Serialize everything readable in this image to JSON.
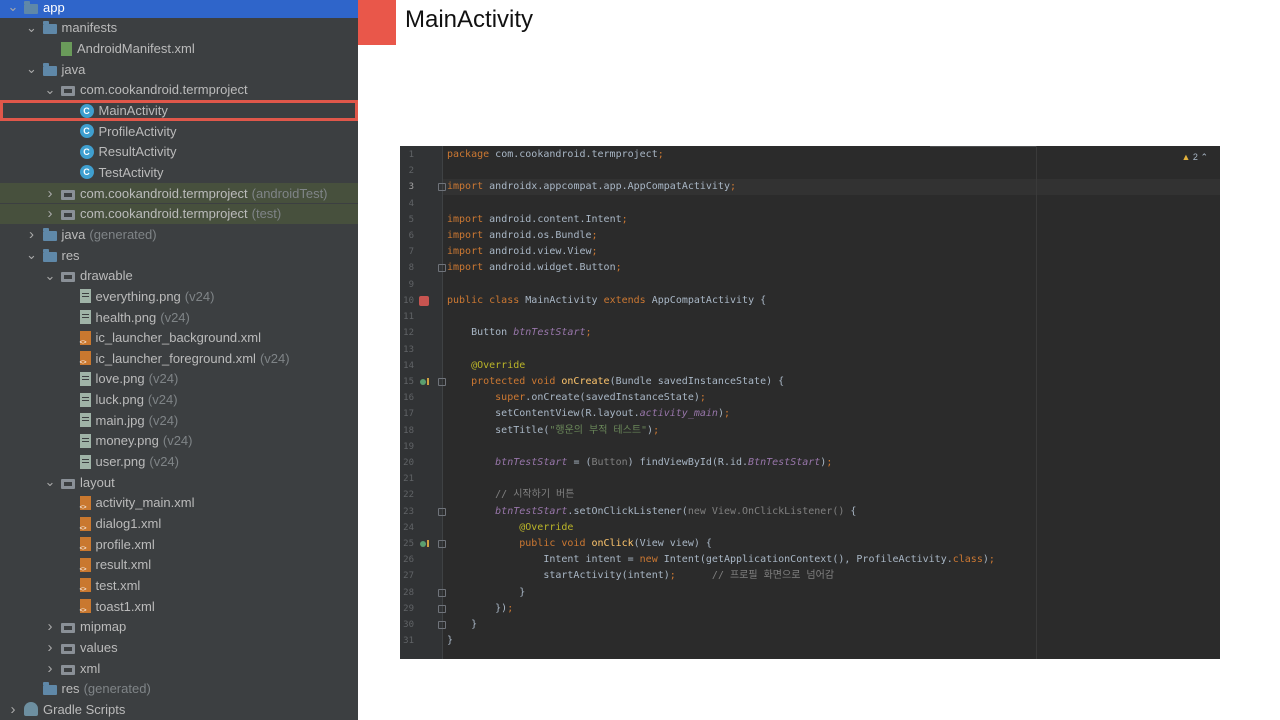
{
  "tree": [
    {
      "label": "app",
      "icon": "folder-icon",
      "chev": "v",
      "indent": 0,
      "selected": true
    },
    {
      "label": "manifests",
      "icon": "folder-icon",
      "chev": "v",
      "indent": 1
    },
    {
      "label": "AndroidManifest.xml",
      "icon": "manifest-file-icon",
      "indent": 2
    },
    {
      "label": "java",
      "icon": "folder-icon",
      "chev": "v",
      "indent": 1
    },
    {
      "label": "com.cookandroid.termproject",
      "icon": "package-icon",
      "chev": "v",
      "indent": 2
    },
    {
      "label": "MainActivity",
      "icon": "class-icon",
      "indent": 3,
      "boxed": true
    },
    {
      "label": "ProfileActivity",
      "icon": "class-icon",
      "indent": 3
    },
    {
      "label": "ResultActivity",
      "icon": "class-icon",
      "indent": 3
    },
    {
      "label": "TestActivity",
      "icon": "class-icon",
      "indent": 3
    },
    {
      "label": "com.cookandroid.termproject",
      "suffix": "(androidTest)",
      "icon": "package-icon",
      "chev": ">",
      "indent": 2,
      "tint": true
    },
    {
      "label": "com.cookandroid.termproject",
      "suffix": "(test)",
      "icon": "package-icon",
      "chev": ">",
      "indent": 2,
      "tint": true
    },
    {
      "label": "java",
      "suffix": "(generated)",
      "icon": "folder-icon",
      "chev": ">",
      "indent": 1
    },
    {
      "label": "res",
      "icon": "res-folder-icon",
      "chev": "v",
      "indent": 1
    },
    {
      "label": "drawable",
      "icon": "package-icon",
      "chev": "v",
      "indent": 2
    },
    {
      "label": "everything.png",
      "suffix": "(v24)",
      "icon": "image-file-icon",
      "indent": 3
    },
    {
      "label": "health.png",
      "suffix": "(v24)",
      "icon": "image-file-icon",
      "indent": 3
    },
    {
      "label": "ic_launcher_background.xml",
      "icon": "xml-file-icon",
      "indent": 3
    },
    {
      "label": "ic_launcher_foreground.xml",
      "suffix": "(v24)",
      "icon": "xml-file-icon",
      "indent": 3
    },
    {
      "label": "love.png",
      "suffix": "(v24)",
      "icon": "image-file-icon",
      "indent": 3
    },
    {
      "label": "luck.png",
      "suffix": "(v24)",
      "icon": "image-file-icon",
      "indent": 3
    },
    {
      "label": "main.jpg",
      "suffix": "(v24)",
      "icon": "image-file-icon",
      "indent": 3
    },
    {
      "label": "money.png",
      "suffix": "(v24)",
      "icon": "image-file-icon",
      "indent": 3
    },
    {
      "label": "user.png",
      "suffix": "(v24)",
      "icon": "image-file-icon",
      "indent": 3
    },
    {
      "label": "layout",
      "icon": "package-icon",
      "chev": "v",
      "indent": 2
    },
    {
      "label": "activity_main.xml",
      "icon": "xml-file-icon",
      "indent": 3
    },
    {
      "label": "dialog1.xml",
      "icon": "xml-file-icon",
      "indent": 3
    },
    {
      "label": "profile.xml",
      "icon": "xml-file-icon",
      "indent": 3
    },
    {
      "label": "result.xml",
      "icon": "xml-file-icon",
      "indent": 3
    },
    {
      "label": "test.xml",
      "icon": "xml-file-icon",
      "indent": 3
    },
    {
      "label": "toast1.xml",
      "icon": "xml-file-icon",
      "indent": 3
    },
    {
      "label": "mipmap",
      "icon": "package-icon",
      "chev": ">",
      "indent": 2
    },
    {
      "label": "values",
      "icon": "package-icon",
      "chev": ">",
      "indent": 2
    },
    {
      "label": "xml",
      "icon": "package-icon",
      "chev": ">",
      "indent": 2
    },
    {
      "label": "res",
      "suffix": "(generated)",
      "icon": "res-folder-icon",
      "indent": 1
    },
    {
      "label": "Gradle Scripts",
      "icon": "gradle-icon",
      "chev": ">",
      "indent": 0
    }
  ],
  "slide": {
    "title": "MainActivity"
  },
  "editor": {
    "warning_count": "2",
    "lines": [
      {
        "n": "1",
        "tokens": [
          [
            "kw",
            "package "
          ],
          [
            "",
            "com.cookandroid.termproject"
          ],
          [
            "kw",
            ";"
          ]
        ]
      },
      {
        "n": "2",
        "tokens": []
      },
      {
        "n": "3",
        "fold": true,
        "tokens": [
          [
            "kw",
            "import "
          ],
          [
            "",
            "androidx.appcompat.app.AppCompatActivity"
          ],
          [
            "kw",
            ";"
          ]
        ]
      },
      {
        "n": "4",
        "tokens": []
      },
      {
        "n": "5",
        "tokens": [
          [
            "kw",
            "import "
          ],
          [
            "",
            "android.content.Intent"
          ],
          [
            "kw",
            ";"
          ]
        ]
      },
      {
        "n": "6",
        "tokens": [
          [
            "kw",
            "import "
          ],
          [
            "",
            "android.os.Bundle"
          ],
          [
            "kw",
            ";"
          ]
        ]
      },
      {
        "n": "7",
        "tokens": [
          [
            "kw",
            "import "
          ],
          [
            "",
            "android.view.View"
          ],
          [
            "kw",
            ";"
          ]
        ]
      },
      {
        "n": "8",
        "fold": true,
        "tokens": [
          [
            "kw",
            "import "
          ],
          [
            "",
            "android.widget.Button"
          ],
          [
            "kw",
            ";"
          ]
        ]
      },
      {
        "n": "9",
        "tokens": []
      },
      {
        "n": "10",
        "marker": "run",
        "tokens": [
          [
            "kw",
            "public class "
          ],
          [
            "",
            "MainActivity "
          ],
          [
            "kw",
            "extends "
          ],
          [
            "",
            "AppCompatActivity {"
          ]
        ]
      },
      {
        "n": "11",
        "tokens": []
      },
      {
        "n": "12",
        "tokens": [
          [
            "",
            "    Button "
          ],
          [
            "it",
            "btnTestStart"
          ],
          [
            "kw",
            ";"
          ]
        ]
      },
      {
        "n": "13",
        "tokens": []
      },
      {
        "n": "14",
        "tokens": [
          [
            "ann",
            "    @Override"
          ]
        ]
      },
      {
        "n": "15",
        "marker": "override",
        "fold": true,
        "tokens": [
          [
            "kw",
            "    protected void "
          ],
          [
            "fn",
            "onCreate"
          ],
          [
            "",
            "(Bundle savedInstanceState) {"
          ]
        ]
      },
      {
        "n": "16",
        "tokens": [
          [
            "kw",
            "        super"
          ],
          [
            "",
            "."
          ],
          [
            "",
            "onCreate(savedInstanceState)"
          ],
          [
            "kw",
            ";"
          ]
        ]
      },
      {
        "n": "17",
        "tokens": [
          [
            "",
            "        setContentView(R.layout."
          ],
          [
            "it",
            "activity_main"
          ],
          [
            "",
            ")"
          ],
          [
            "kw",
            ";"
          ]
        ]
      },
      {
        "n": "18",
        "tokens": [
          [
            "",
            "        setTitle("
          ],
          [
            "str",
            "\"행운의 부적 테스트\""
          ],
          [
            "",
            ")"
          ],
          [
            "kw",
            ";"
          ]
        ]
      },
      {
        "n": "19",
        "tokens": []
      },
      {
        "n": "20",
        "tokens": [
          [
            "it",
            "        btnTestStart "
          ],
          [
            "",
            "= ("
          ],
          [
            "cm",
            "Button"
          ],
          [
            "",
            ") findViewById(R.id."
          ],
          [
            "it",
            "BtnTestStart"
          ],
          [
            "",
            ")"
          ],
          [
            "kw",
            ";"
          ]
        ]
      },
      {
        "n": "21",
        "tokens": []
      },
      {
        "n": "22",
        "tokens": [
          [
            "cm",
            "        // 시작하기 버튼"
          ]
        ]
      },
      {
        "n": "23",
        "fold": true,
        "tokens": [
          [
            "it",
            "        btnTestStart"
          ],
          [
            "",
            ".setOnClickListener("
          ],
          [
            "cm",
            "new View.OnClickListener() "
          ],
          [
            "",
            "{"
          ]
        ]
      },
      {
        "n": "24",
        "tokens": [
          [
            "ann",
            "            @Override"
          ]
        ]
      },
      {
        "n": "25",
        "marker": "override",
        "fold": true,
        "tokens": [
          [
            "kw",
            "            public void "
          ],
          [
            "fn",
            "onClick"
          ],
          [
            "",
            "(View view) {"
          ]
        ]
      },
      {
        "n": "26",
        "tokens": [
          [
            "",
            "                Intent intent = "
          ],
          [
            "kw",
            "new "
          ],
          [
            "",
            "Intent(getApplicationContext(), ProfileActivity."
          ],
          [
            "kw",
            "class"
          ],
          [
            "",
            ")"
          ],
          [
            "kw",
            ";"
          ]
        ]
      },
      {
        "n": "27",
        "tokens": [
          [
            "",
            "                startActivity(intent)"
          ],
          [
            "kw",
            ";"
          ],
          [
            "cm",
            "      // 프로필 화면으로 넘어감"
          ]
        ]
      },
      {
        "n": "28",
        "fold": true,
        "tokens": [
          [
            "",
            "            }"
          ]
        ]
      },
      {
        "n": "29",
        "fold": true,
        "tokens": [
          [
            "",
            "        })"
          ],
          [
            "kw",
            ";"
          ]
        ]
      },
      {
        "n": "30",
        "fold": true,
        "tokens": [
          [
            "",
            "    }"
          ]
        ]
      },
      {
        "n": "31",
        "tokens": [
          [
            "",
            "}"
          ]
        ]
      }
    ]
  }
}
